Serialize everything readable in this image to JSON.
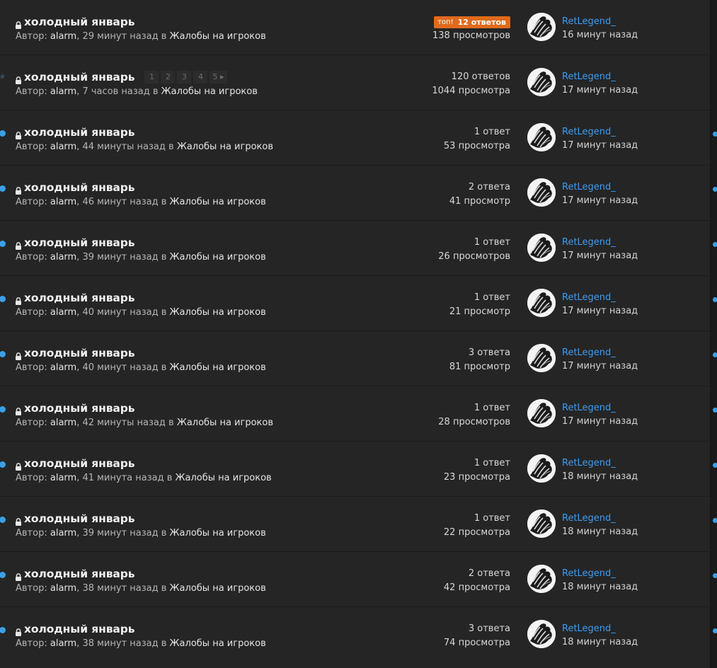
{
  "colors": {
    "accent": "#3aa0e6",
    "badge": "#e06a1b",
    "link": "#3f9bf0"
  },
  "topics": [
    {
      "title": "холодный январь",
      "locked": true,
      "marker": "none",
      "author": "alarm",
      "ago": ", 29 минут назад в ",
      "forum": "Жалобы на игроков",
      "badge_tag": "топ!",
      "badge_label": "12 ответов",
      "replies": "",
      "views": "138 просмотров",
      "last_user": "RetLegend_",
      "last_time": "16 минут назад",
      "pages": []
    },
    {
      "title": "холодный январь",
      "locked": true,
      "marker": "star",
      "author": "alarm",
      "ago": ", 7 часов назад в ",
      "forum": "Жалобы на игроков",
      "badge_tag": "",
      "badge_label": "",
      "replies": "120 ответов",
      "views": "1044 просмотра",
      "last_user": "RetLegend_",
      "last_time": "17 минут назад",
      "pages": [
        "1",
        "2",
        "3",
        "4",
        "5 ▸"
      ]
    },
    {
      "title": "холодный январь",
      "locked": true,
      "marker": "dot",
      "author": "alarm",
      "ago": ", 44 минуты назад в ",
      "forum": "Жалобы на игроков",
      "badge_tag": "",
      "badge_label": "",
      "replies": "1 ответ",
      "views": "53 просмотра",
      "last_user": "RetLegend_",
      "last_time": "17 минут назад",
      "pages": []
    },
    {
      "title": "холодный январь",
      "locked": true,
      "marker": "dot",
      "author": "alarm",
      "ago": ", 46 минут назад в ",
      "forum": "Жалобы на игроков",
      "badge_tag": "",
      "badge_label": "",
      "replies": "2 ответа",
      "views": "41 просмотр",
      "last_user": "RetLegend_",
      "last_time": "17 минут назад",
      "pages": []
    },
    {
      "title": "холодный январь",
      "locked": true,
      "marker": "dot",
      "author": "alarm",
      "ago": ", 39 минут назад в ",
      "forum": "Жалобы на игроков",
      "badge_tag": "",
      "badge_label": "",
      "replies": "1 ответ",
      "views": "26 просмотров",
      "last_user": "RetLegend_",
      "last_time": "17 минут назад",
      "pages": []
    },
    {
      "title": "холодный январь",
      "locked": true,
      "marker": "dot",
      "author": "alarm",
      "ago": ", 40 минут назад в ",
      "forum": "Жалобы на игроков",
      "badge_tag": "",
      "badge_label": "",
      "replies": "1 ответ",
      "views": "21 просмотр",
      "last_user": "RetLegend_",
      "last_time": "17 минут назад",
      "pages": []
    },
    {
      "title": "холодный январь",
      "locked": true,
      "marker": "dot",
      "author": "alarm",
      "ago": ", 40 минут назад в ",
      "forum": "Жалобы на игроков",
      "badge_tag": "",
      "badge_label": "",
      "replies": "3 ответа",
      "views": "81 просмотр",
      "last_user": "RetLegend_",
      "last_time": "17 минут назад",
      "pages": []
    },
    {
      "title": "холодный январь",
      "locked": true,
      "marker": "dot",
      "author": "alarm",
      "ago": ", 42 минуты назад в ",
      "forum": "Жалобы на игроков",
      "badge_tag": "",
      "badge_label": "",
      "replies": "1 ответ",
      "views": "28 просмотров",
      "last_user": "RetLegend_",
      "last_time": "17 минут назад",
      "pages": []
    },
    {
      "title": "холодный январь",
      "locked": true,
      "marker": "dot",
      "author": "alarm",
      "ago": ", 41 минута назад в ",
      "forum": "Жалобы на игроков",
      "badge_tag": "",
      "badge_label": "",
      "replies": "1 ответ",
      "views": "23 просмотра",
      "last_user": "RetLegend_",
      "last_time": "18 минут назад",
      "pages": []
    },
    {
      "title": "холодный январь",
      "locked": true,
      "marker": "dot",
      "author": "alarm",
      "ago": ", 39 минут назад в ",
      "forum": "Жалобы на игроков",
      "badge_tag": "",
      "badge_label": "",
      "replies": "1 ответ",
      "views": "22 просмотра",
      "last_user": "RetLegend_",
      "last_time": "18 минут назад",
      "pages": []
    },
    {
      "title": "холодный январь",
      "locked": true,
      "marker": "dot",
      "author": "alarm",
      "ago": ", 38 минут назад в ",
      "forum": "Жалобы на игроков",
      "badge_tag": "",
      "badge_label": "",
      "replies": "2 ответа",
      "views": "42 просмотра",
      "last_user": "RetLegend_",
      "last_time": "18 минут назад",
      "pages": []
    },
    {
      "title": "холодный январь",
      "locked": true,
      "marker": "dot",
      "author": "alarm",
      "ago": ", 38 минут назад в ",
      "forum": "Жалобы на игроков",
      "badge_tag": "",
      "badge_label": "",
      "replies": "3 ответа",
      "views": "74 просмотра",
      "last_user": "RetLegend_",
      "last_time": "18 минут назад",
      "pages": []
    }
  ],
  "meta": {
    "author_prefix": "Автор: "
  }
}
